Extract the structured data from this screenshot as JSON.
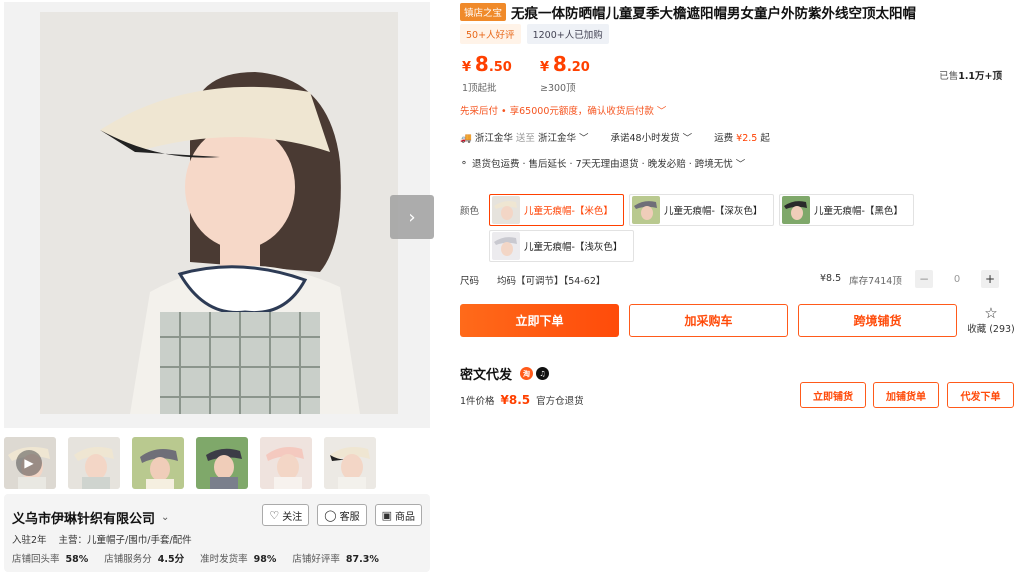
{
  "gallery": {
    "next_arrow_icon": "chevron-right-icon",
    "thumbs": [
      {
        "id": "t1",
        "video": true
      },
      {
        "id": "t2"
      },
      {
        "id": "t3"
      },
      {
        "id": "t4"
      },
      {
        "id": "t5"
      },
      {
        "id": "t6"
      }
    ]
  },
  "shop": {
    "name": "义乌市伊琳针织有限公司",
    "follow_label": "关注",
    "service_label": "客服",
    "goods_label": "商品",
    "years": "入驻2年",
    "main_business": "主营：儿童帽子/围巾/手套/配件",
    "stats": [
      {
        "label": "店铺回头率",
        "value": "58%"
      },
      {
        "label": "店铺服务分",
        "value": "4.5分"
      },
      {
        "label": "准时发货率",
        "value": "98%"
      },
      {
        "label": "店铺好评率",
        "value": "87.3%"
      }
    ]
  },
  "product": {
    "badge": "镇店之宝",
    "title": "无痕一体防晒帽儿童夏季大檐遮阳帽男女童户外防紫外线空顶太阳帽",
    "tag_reviews": "50+人好评",
    "tag_purchased": "1200+人已加购",
    "prices": [
      {
        "yen": "¥",
        "int": "8",
        "dec": ".50",
        "sub": "1顶起批"
      },
      {
        "yen": "¥",
        "int": "8",
        "dec": ".20",
        "sub": "≥300顶"
      }
    ],
    "sold_prefix": "已售",
    "sold_value": "1.1万+顶",
    "credit": "先采后付 • 享65000元额度，确认收货后付款 ﹀",
    "ship_from": "浙江金华",
    "ship_to_word": "送至",
    "ship_to": "浙江金华 ﹀",
    "promise": "承诺48小时发货 ﹀",
    "freight_label": "运费",
    "freight_value": "¥2.5",
    "freight_suffix": "起",
    "services": "退货包运费 · 售后延长 · 7天无理由退货 · 晚发必赔 · 跨境无忧 ﹀",
    "color_label": "颜色",
    "variants": [
      {
        "label": "儿童无痕帽-【米色】",
        "selected": true,
        "swatch": "#efe6d2"
      },
      {
        "label": "儿童无痕帽-【深灰色】",
        "selected": false,
        "swatch": "#6f6f78"
      },
      {
        "label": "儿童无痕帽-【黑色】",
        "selected": false,
        "swatch": "#2a2a2a"
      },
      {
        "label": "儿童无痕帽-【浅灰色】",
        "selected": false,
        "swatch": "#c9c9d0"
      }
    ],
    "size_label": "尺码",
    "size_value": "均码【可调节】【54-62】",
    "unit_price": "¥8.5",
    "stock": "库存7414顶",
    "quantity": "0",
    "buy_now": "立即下单",
    "add_cart": "加采购车",
    "cross_border": "跨境铺货",
    "favorite": "收藏 (293)"
  },
  "dropship": {
    "title": "密文代发",
    "one_piece_label": "1件价格",
    "one_piece_price": "¥8.5",
    "return_note": "官方仓退货",
    "btn_list_now": "立即铺货",
    "btn_add_list": "加铺货单",
    "btn_ship_order": "代发下单"
  },
  "colors": {
    "accent": "#ff4000",
    "badge": "#f08a2a"
  }
}
